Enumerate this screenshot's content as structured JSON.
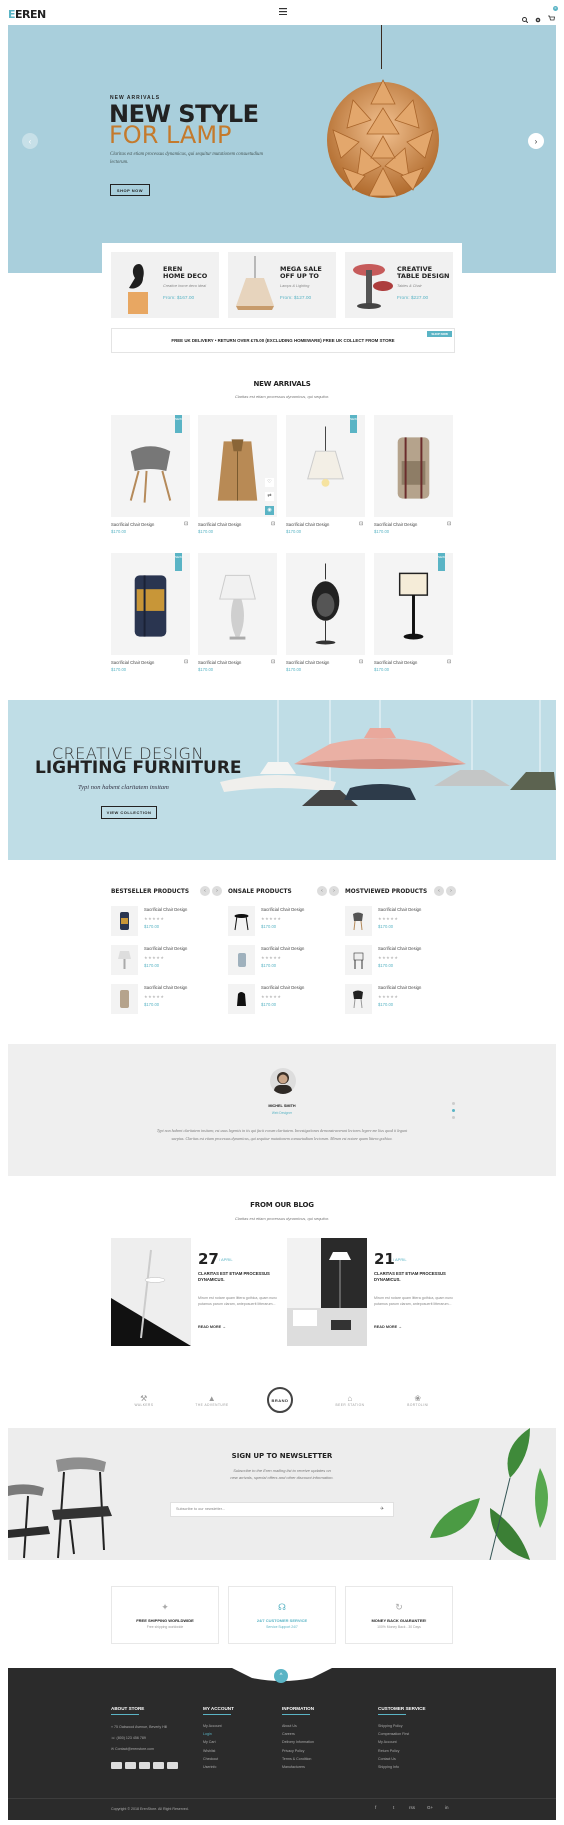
{
  "header": {
    "logo_mark": "E",
    "logo_text": "EREN",
    "menu_icon": "hamburger-icon",
    "search_icon": "search-icon",
    "settings_icon": "gear-icon",
    "cart_icon": "cart-icon",
    "cart_count": "0"
  },
  "hero": {
    "subtitle": "NEW ARRIVALS",
    "title_line1": "NEW STYLE",
    "title_line2": "FOR LAMP",
    "text": "Claritas est etiam processus dynamicus, qui sequitur mutationem consuetudium lectorum.",
    "button": "SHOP NOW",
    "accent": "#c47a2c",
    "bg": "#a9cfdc"
  },
  "promos": [
    {
      "title1": "EREN",
      "title2": "HOME DECO",
      "sub": "Creative home deco ideal",
      "price": "From: $167.00"
    },
    {
      "title1": "MEGA SALE",
      "title2": "OFF UP TO",
      "sub": "Lamps & Lighting",
      "price": "From: $127.00"
    },
    {
      "title1": "CREATIVE",
      "title2": "TABLE DESIGN",
      "sub": "Tables & Chair",
      "price": "From: $227.00"
    }
  ],
  "shipping": {
    "text": "FREE UK DELIVERY • RETURN OVER £75.00 (EXCLUDING HOMEWARE) FREE UK COLLECT FROM STORE",
    "tag": "SHOP NOW"
  },
  "new_arrivals": {
    "title": "NEW ARRIVALS",
    "subtitle": "Claritas est etiam processus dynamicus, qui sequitur.",
    "products": [
      {
        "name": "Sacrificial Chair Design",
        "price": "$170.00",
        "ribbon": "NEW"
      },
      {
        "name": "Sacrificial Chair Design",
        "price": "$170.00",
        "ribbon": ""
      },
      {
        "name": "Sacrificial Chair Design",
        "price": "$170.00",
        "ribbon": "NEW"
      },
      {
        "name": "Sacrificial Chair Design",
        "price": "$170.00",
        "ribbon": ""
      },
      {
        "name": "Sacrificial Chair Design",
        "price": "$170.00",
        "ribbon": "NEW"
      },
      {
        "name": "Sacrificial Chair Design",
        "price": "$170.00",
        "ribbon": ""
      },
      {
        "name": "Sacrificial Chair Design",
        "price": "$170.00",
        "ribbon": ""
      },
      {
        "name": "Sacrificial Chair Design",
        "price": "$170.00",
        "ribbon": "NEW"
      }
    ]
  },
  "banner": {
    "line1": "CREATIVE DESIGN",
    "line2": "LIGHTING FURNITURE",
    "line3": "Typi non habent claritatem insitam",
    "button": "VIEW COLLECTION"
  },
  "product_lists": [
    {
      "title": "BESTSELLER PRODUCTS",
      "items": [
        {
          "name": "Sacrificial Chair Design",
          "price": "$170.00"
        },
        {
          "name": "Sacrificial Chair Design",
          "price": "$170.00"
        },
        {
          "name": "Sacrificial Chair Design",
          "price": "$170.00"
        }
      ]
    },
    {
      "title": "ONSALE PRODUCTS",
      "items": [
        {
          "name": "Sacrificial Chair Design",
          "price": "$170.00"
        },
        {
          "name": "Sacrificial Chair Design",
          "price": "$170.00"
        },
        {
          "name": "Sacrificial Chair Design",
          "price": "$170.00"
        }
      ]
    },
    {
      "title": "MOSTVIEWED PRODUCTS",
      "items": [
        {
          "name": "Sacrificial Chair Design",
          "price": "$170.00"
        },
        {
          "name": "Sacrificial Chair Design",
          "price": "$170.00"
        },
        {
          "name": "Sacrificial Chair Design",
          "price": "$170.00"
        }
      ]
    }
  ],
  "testimonial": {
    "name": "MICHEL SMITH",
    "role": "Web Designer",
    "text": "Typi non habent claritatem insitam; est usus legentis in iis qui facit eorum claritatem. Investigationes demonstraverunt lectores legere me lius quod ii legunt saepius. Claritas est etiam processus dynamicus, qui sequitur mutationem consuetudium lectorum. Mirum est notare quam littera gothica."
  },
  "blog": {
    "title": "FROM OUR BLOG",
    "subtitle": "Claritas est etiam processus dynamicus, qui sequitur.",
    "posts": [
      {
        "day": "27",
        "month": "/ APRIL",
        "title": "CLARITAS EST ETIAM PROCESSUS DYNAMICUS.",
        "excerpt": "Mirum est notare quam littera gothica, quam nunc putamus parum claram, anteposuerit litterarum...",
        "more": "READ MORE  →"
      },
      {
        "day": "21",
        "month": "/ APRIL",
        "title": "CLARITAS EST ETIAM PROCESSUS DYNAMICUS.",
        "excerpt": "Mirum est notare quam littera gothica, quam nunc putamus parum claram, anteposuerit litterarum...",
        "more": "READ MORE  →"
      }
    ]
  },
  "brands": [
    "WALKERS",
    "THE ADVENTURE",
    "BRAND",
    "BEER STATION",
    "BORTOLINI"
  ],
  "newsletter": {
    "title": "SIGN UP TO NEWSLETTER",
    "subtitle": "Subscribe to the Eren mailing list to receive updates on new arrivals, special offers and other discount information.",
    "placeholder": "Subscribe to our newsletter..."
  },
  "features": [
    {
      "icon": "rocket-icon",
      "title": "FREE SHIPPING WORLDWIDE",
      "sub": "Free shipping worldwide",
      "color": "#222"
    },
    {
      "icon": "headset-icon",
      "title": "24/7 CUSTOMER SERVICE",
      "sub": "Service Support 24/7",
      "color": "#5ab4c5"
    },
    {
      "icon": "refresh-icon",
      "title": "MONEY BACK GUARANTEE!",
      "sub": "100% Money Back - 30 Days",
      "color": "#222"
    }
  ],
  "footer": {
    "about": {
      "title": "ABOUT STORE",
      "address": "75 Oakwood Avenue, Beverly Hill",
      "phone": "(800) 123 456 789",
      "email": "Contact@erenstore.com"
    },
    "account": {
      "title": "MY ACCOUNT",
      "links": [
        "My Account",
        "Login",
        "My Cart",
        "Wishlist",
        "Checkout",
        "Userinfo"
      ]
    },
    "information": {
      "title": "INFORMATION",
      "links": [
        "About Us",
        "Careers",
        "Delivery Information",
        "Privacy Policy",
        "Terms & Condition",
        "Manufacturers"
      ]
    },
    "service": {
      "title": "CUSTOMER SERVICE",
      "links": [
        "Shipping Policy",
        "Compensation First",
        "My Account",
        "Return Policy",
        "Contact Us",
        "Shipping Info"
      ]
    },
    "copyright": "Copyright © 2018 ErenStore. All Right Reserved.",
    "social": [
      "f",
      "t",
      "rss",
      "G+",
      "in"
    ]
  }
}
